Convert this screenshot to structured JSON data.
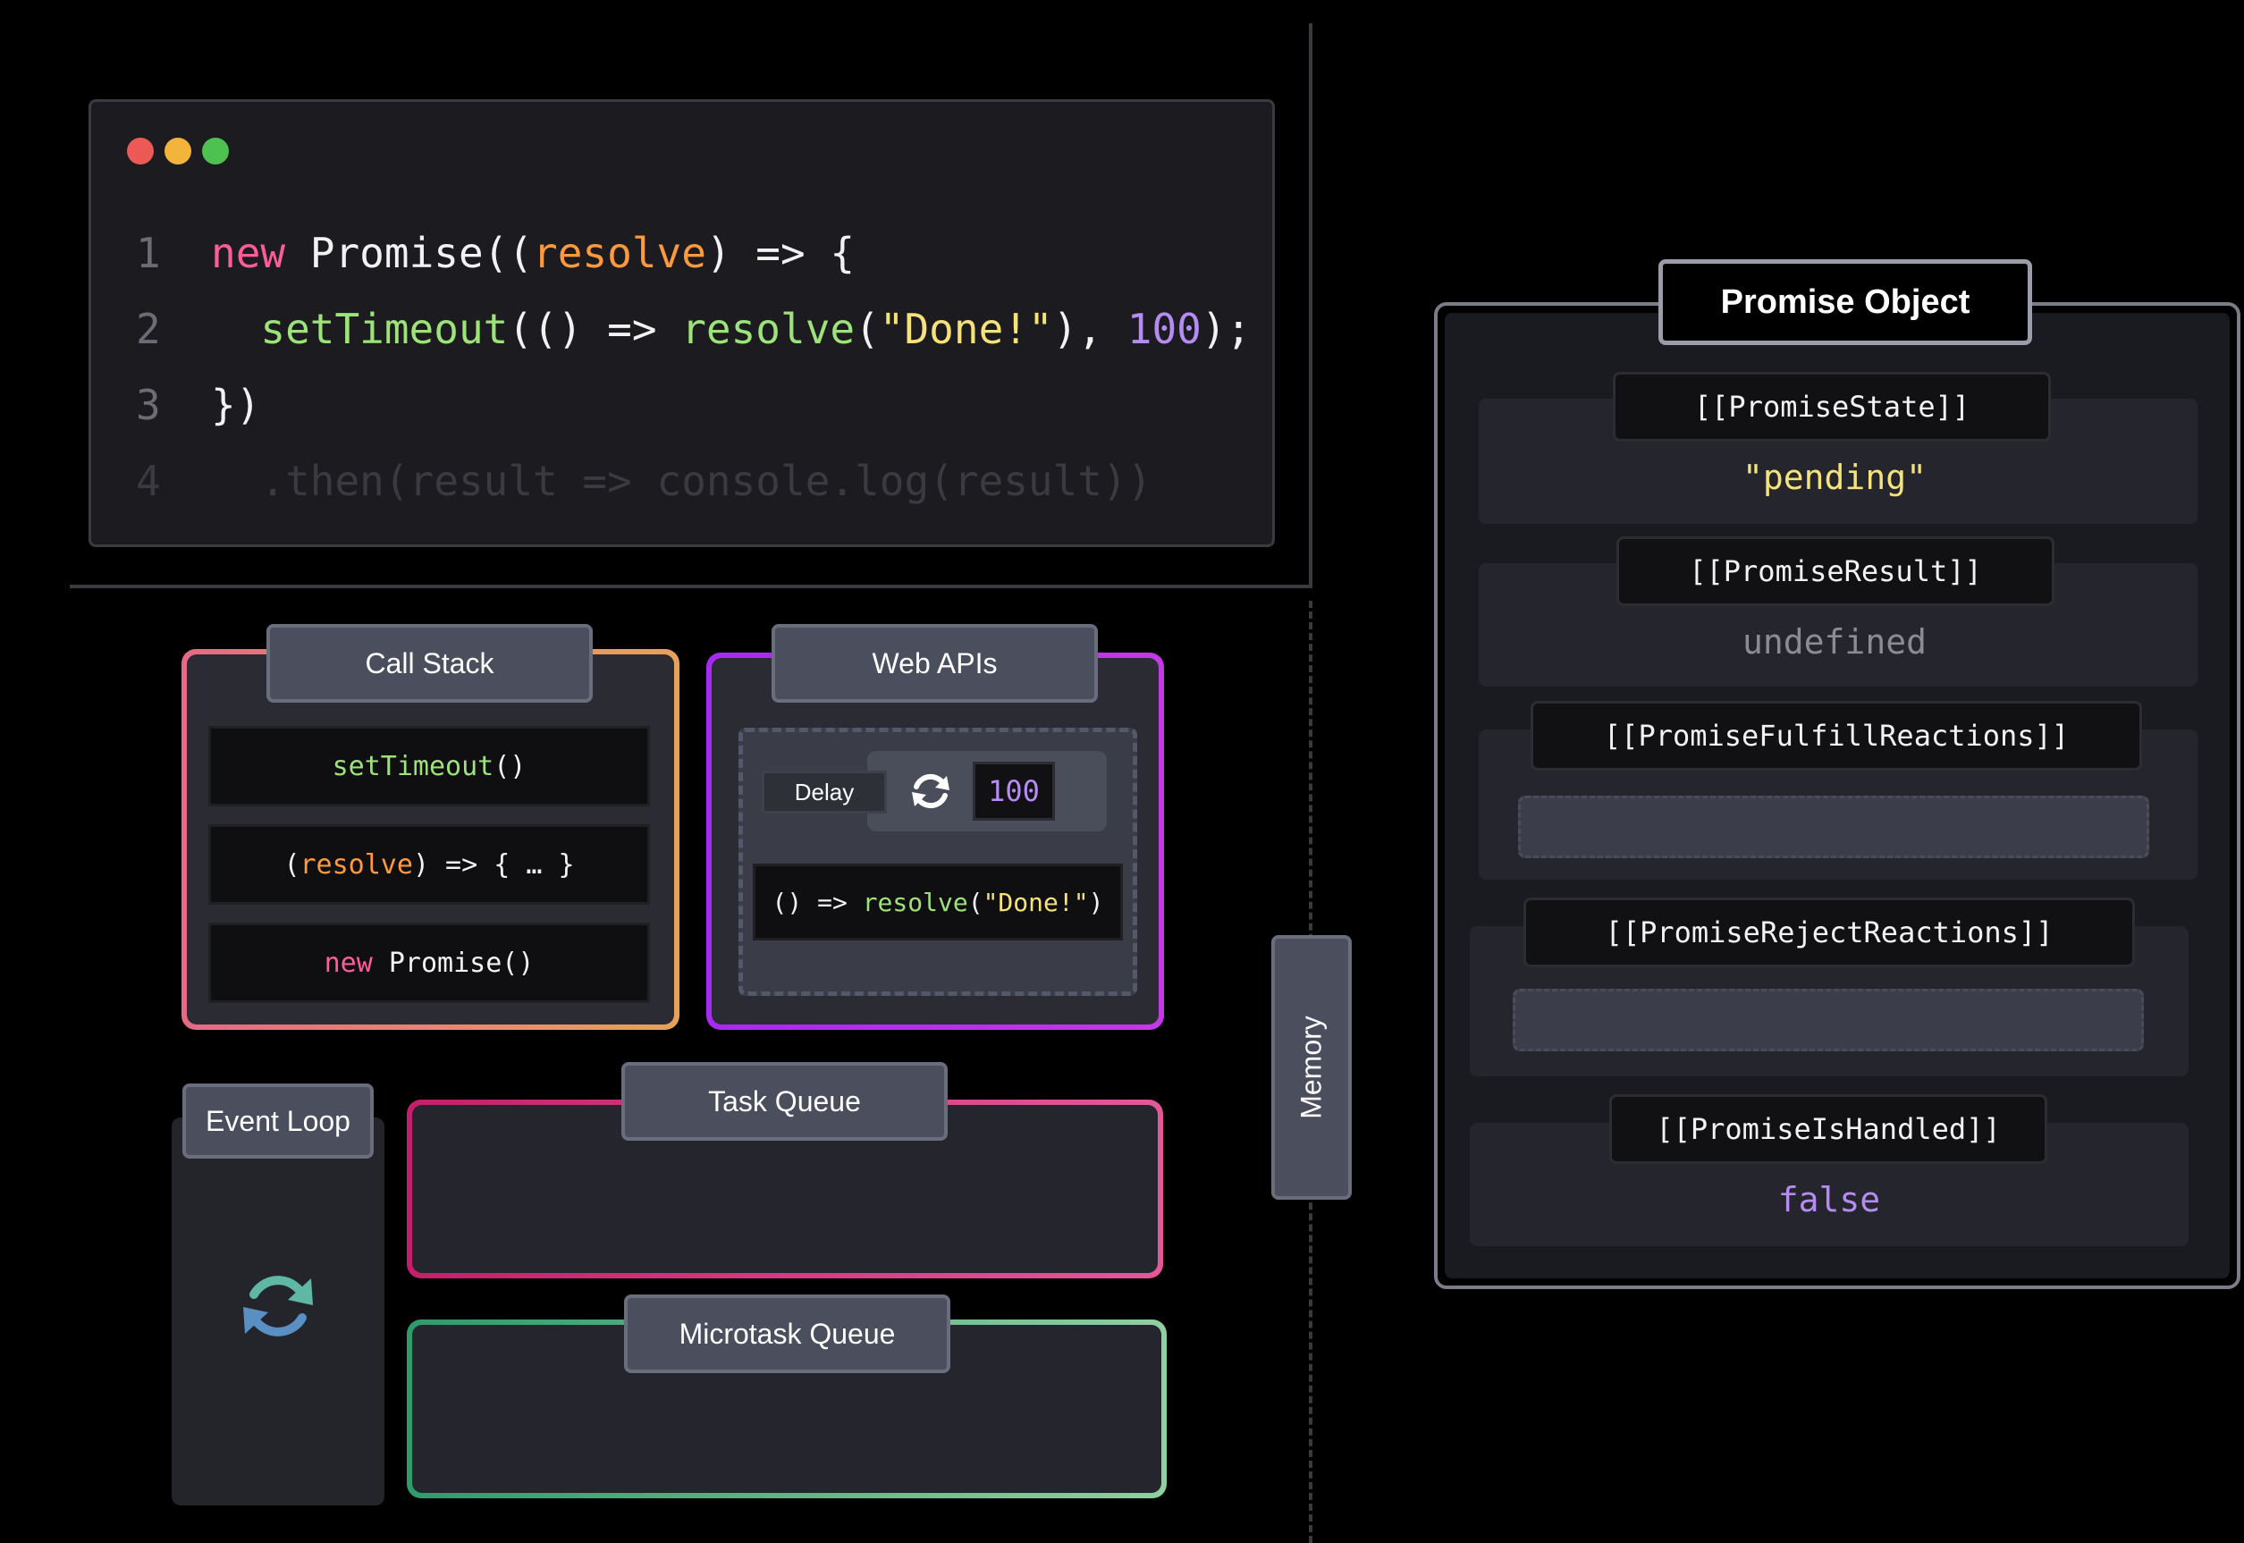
{
  "code_editor": {
    "lines": [
      {
        "number": "1",
        "tokens": [
          {
            "text": "new",
            "cls": "kw"
          },
          {
            "text": " Promise((",
            "cls": "fn"
          },
          {
            "text": "resolve",
            "cls": "param"
          },
          {
            "text": ") => {",
            "cls": "punc"
          }
        ]
      },
      {
        "number": "2",
        "tokens": [
          {
            "text": "  setTimeout",
            "cls": "call"
          },
          {
            "text": "(() => ",
            "cls": "punc"
          },
          {
            "text": "resolve",
            "cls": "call"
          },
          {
            "text": "(",
            "cls": "punc"
          },
          {
            "text": "\"Done!\"",
            "cls": "str"
          },
          {
            "text": "), ",
            "cls": "punc"
          },
          {
            "text": "100",
            "cls": "num"
          },
          {
            "text": ");",
            "cls": "punc"
          }
        ]
      },
      {
        "number": "3",
        "tokens": [
          {
            "text": "})",
            "cls": "punc"
          }
        ]
      },
      {
        "number": "4",
        "tokens": [
          {
            "text": "  .then(result => console.log(result))",
            "cls": "ghost"
          }
        ]
      }
    ],
    "colors": {
      "close": "#ed5a55",
      "minimize": "#f2b43a",
      "maximize": "#4ec150"
    }
  },
  "call_stack": {
    "title": "Call Stack",
    "frames": [
      [
        {
          "text": "setTimeout",
          "cls": "call"
        },
        {
          "text": "()",
          "cls": "punc"
        }
      ],
      [
        {
          "text": "(",
          "cls": "punc"
        },
        {
          "text": "resolve",
          "cls": "param"
        },
        {
          "text": ") => { … }",
          "cls": "punc"
        }
      ],
      [
        {
          "text": "new",
          "cls": "kw"
        },
        {
          "text": " Promise()",
          "cls": "punc"
        }
      ]
    ]
  },
  "web_apis": {
    "title": "Web APIs",
    "delay_label": "Delay",
    "delay_value": "100",
    "callback": [
      {
        "text": "() => ",
        "cls": "punc"
      },
      {
        "text": "resolve",
        "cls": "call"
      },
      {
        "text": "(",
        "cls": "punc"
      },
      {
        "text": "\"Done!\"",
        "cls": "str"
      },
      {
        "text": ")",
        "cls": "punc"
      }
    ]
  },
  "event_loop": {
    "title": "Event Loop"
  },
  "task_queue": {
    "title": "Task Queue"
  },
  "microtask_queue": {
    "title": "Microtask Queue"
  },
  "memory": {
    "label": "Memory"
  },
  "promise_object": {
    "title": "Promise Object",
    "state_label": "[[PromiseState]]",
    "state_value": "\"pending\"",
    "result_label": "[[PromiseResult]]",
    "result_value": "undefined",
    "fulfill_label": "[[PromiseFulfillReactions]]",
    "reject_label": "[[PromiseRejectReactions]]",
    "handled_label": "[[PromiseIsHandled]]",
    "handled_value": "false"
  }
}
